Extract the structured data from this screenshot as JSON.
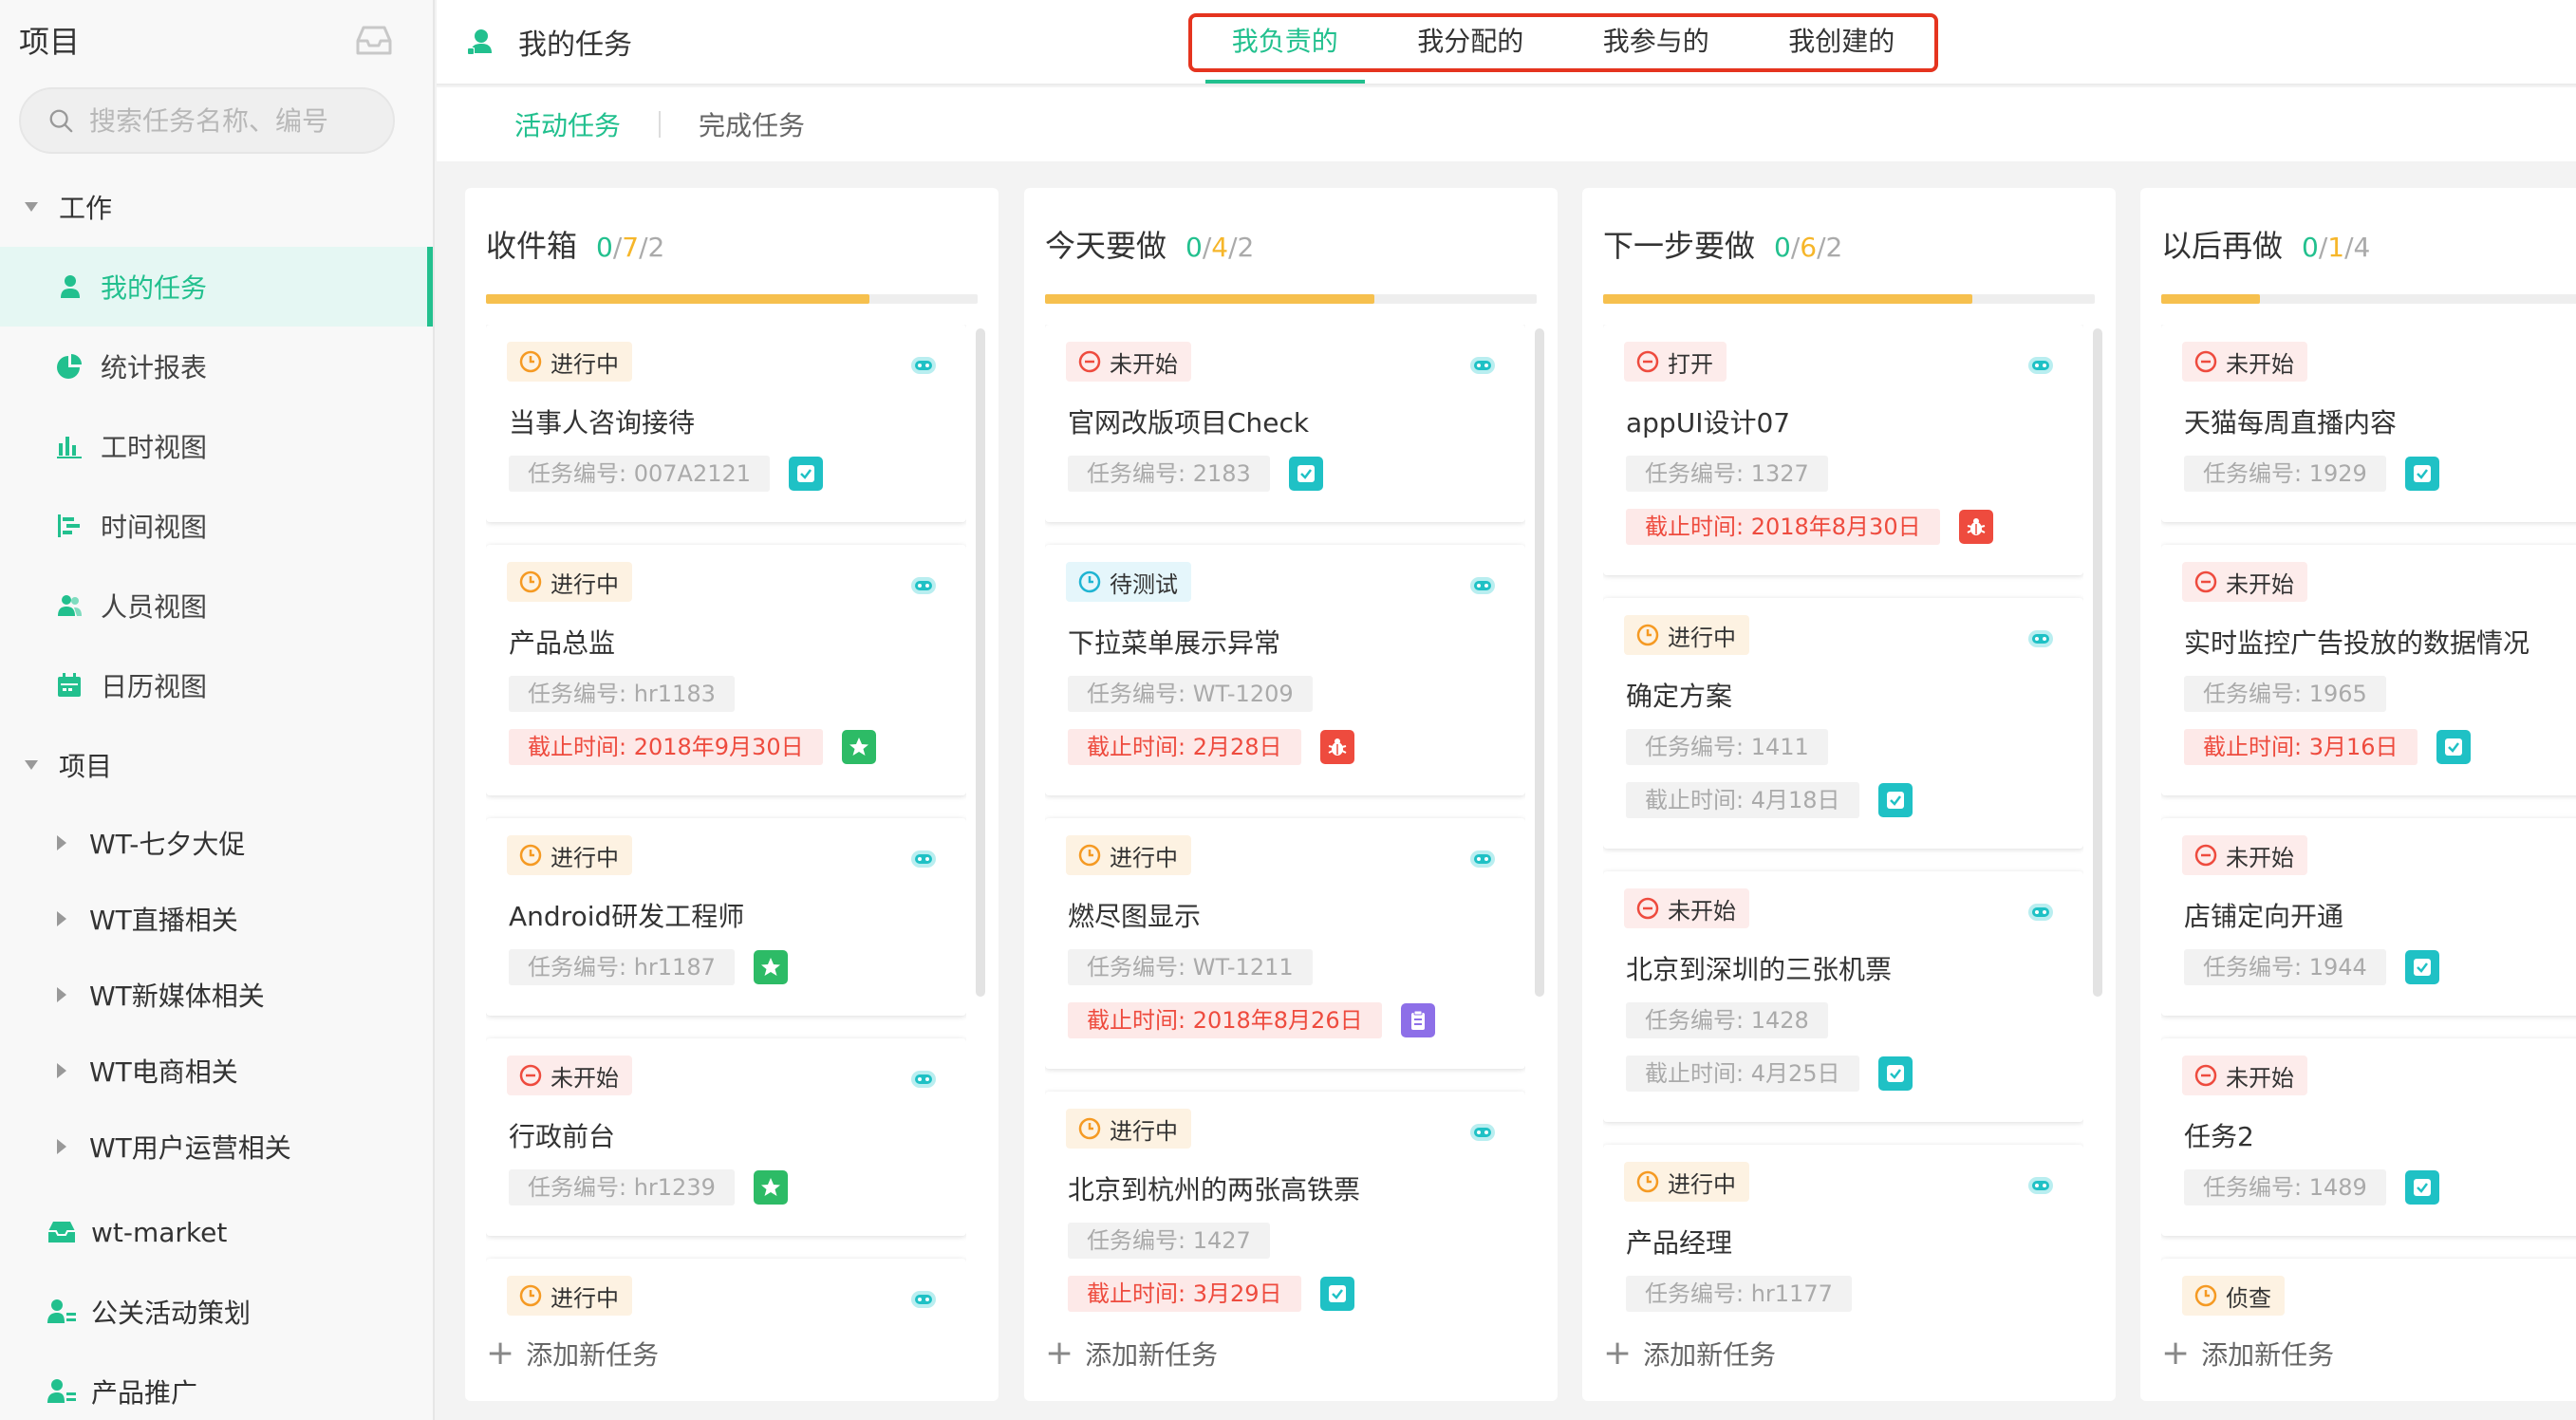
{
  "sidebar": {
    "title": "项目",
    "search_placeholder": "搜索任务名称、编号",
    "work_group": "工作",
    "work_items": [
      {
        "label": "我的任务",
        "icon": "user-icon",
        "active": true
      },
      {
        "label": "统计报表",
        "icon": "pie-chart-icon"
      },
      {
        "label": "工时视图",
        "icon": "bar-chart-icon"
      },
      {
        "label": "时间视图",
        "icon": "gantt-icon"
      },
      {
        "label": "人员视图",
        "icon": "users-icon"
      },
      {
        "label": "日历视图",
        "icon": "calendar-icon"
      }
    ],
    "project_group": "项目",
    "projects": [
      "WT-七夕大促",
      "WT直播相关",
      "WT新媒体相关",
      "WT电商相关",
      "WT用户运营相关"
    ],
    "other_projects": [
      {
        "label": "wt-market",
        "icon": "inbox-icon"
      },
      {
        "label": "公关活动策划",
        "icon": "user-list-icon"
      },
      {
        "label": "产品推广",
        "icon": "user-list-icon"
      }
    ]
  },
  "header": {
    "title": "我的任务",
    "tabs": [
      "我负责的",
      "我分配的",
      "我参与的",
      "我创建的"
    ],
    "active_tab": 0
  },
  "subtabs": [
    "活动任务",
    "完成任务"
  ],
  "columns": [
    {
      "title": "收件箱",
      "count_done": "0",
      "count_total": "7",
      "count_other": "2",
      "progress": 0.78,
      "cards": [
        {
          "status": "进行中",
          "status_type": "orange",
          "title": "当事人咨询接待",
          "number": "任务编号: 007A2121",
          "type_icon": "check-icon",
          "type_color": "teal"
        },
        {
          "status": "进行中",
          "status_type": "orange",
          "title": "产品总监",
          "number": "任务编号: hr1183",
          "due": "截止时间: 2018年9月30日",
          "due_style": "red",
          "type_icon": "star-icon",
          "type_color": "green"
        },
        {
          "status": "进行中",
          "status_type": "orange",
          "title": "Android研发工程师",
          "number": "任务编号: hr1187",
          "type_icon": "star-icon",
          "type_color": "green"
        },
        {
          "status": "未开始",
          "status_type": "red",
          "title": "行政前台",
          "number": "任务编号: hr1239",
          "type_icon": "star-icon",
          "type_color": "green"
        },
        {
          "status": "进行中",
          "status_type": "orange",
          "title": "",
          "number": ""
        }
      ]
    },
    {
      "title": "今天要做",
      "count_done": "0",
      "count_total": "4",
      "count_other": "2",
      "progress": 0.67,
      "cards": [
        {
          "status": "未开始",
          "status_type": "red",
          "title": "官网改版项目Check",
          "number": "任务编号: 2183",
          "type_icon": "check-icon",
          "type_color": "teal"
        },
        {
          "status": "待测试",
          "status_type": "blue",
          "title": "下拉菜单展示异常",
          "number": "任务编号: WT-1209",
          "due": "截止时间: 2月28日",
          "due_style": "red",
          "type_icon": "bug-icon",
          "type_color": "red"
        },
        {
          "status": "进行中",
          "status_type": "orange",
          "title": "燃尽图显示",
          "number": "任务编号: WT-1211",
          "due": "截止时间: 2018年8月26日",
          "due_style": "red",
          "type_icon": "clipboard-icon",
          "type_color": "purple"
        },
        {
          "status": "进行中",
          "status_type": "orange",
          "title": "北京到杭州的两张高铁票",
          "number": "任务编号: 1427",
          "due": "截止时间: 3月29日",
          "due_style": "red",
          "type_icon": "check-icon",
          "type_color": "teal"
        }
      ]
    },
    {
      "title": "下一步要做",
      "count_done": "0",
      "count_total": "6",
      "count_other": "2",
      "progress": 0.75,
      "cards": [
        {
          "status": "打开",
          "status_type": "red",
          "title": "appUI设计07",
          "number": "任务编号: 1327",
          "due": "截止时间: 2018年8月30日",
          "due_style": "red",
          "type_icon": "bug-icon",
          "type_color": "red"
        },
        {
          "status": "进行中",
          "status_type": "orange",
          "title": "确定方案",
          "number": "任务编号: 1411",
          "due": "截止时间: 4月18日",
          "due_style": "grey",
          "type_icon": "check-icon",
          "type_color": "teal"
        },
        {
          "status": "未开始",
          "status_type": "red",
          "title": "北京到深圳的三张机票",
          "number": "任务编号: 1428",
          "due": "截止时间: 4月25日",
          "due_style": "grey",
          "type_icon": "check-icon",
          "type_color": "teal"
        },
        {
          "status": "进行中",
          "status_type": "orange",
          "title": "产品经理",
          "number": "任务编号: hr1177"
        }
      ]
    },
    {
      "title": "以后再做",
      "count_done": "0",
      "count_total": "1",
      "count_other": "4",
      "progress": 0.2,
      "cards": [
        {
          "status": "未开始",
          "status_type": "red",
          "title": "天猫每周直播内容",
          "number": "任务编号: 1929",
          "type_icon": "check-icon",
          "type_color": "teal"
        },
        {
          "status": "未开始",
          "status_type": "red",
          "title": "实时监控广告投放的数据情况",
          "number": "任务编号: 1965",
          "due": "截止时间: 3月16日",
          "due_style": "red",
          "type_icon": "check-icon",
          "type_color": "teal"
        },
        {
          "status": "未开始",
          "status_type": "red",
          "title": "店铺定向开通",
          "number": "任务编号: 1944",
          "type_icon": "check-icon",
          "type_color": "teal"
        },
        {
          "status": "未开始",
          "status_type": "red",
          "title": "任务2",
          "number": "任务编号: 1489",
          "type_icon": "check-icon",
          "type_color": "teal"
        },
        {
          "status": "侦查",
          "status_type": "orange",
          "title": "",
          "number": ""
        }
      ]
    }
  ],
  "add_task_label": "添加新任务",
  "colors": {
    "accent": "#22c08e",
    "highlight_border": "#e5341f",
    "progress": "#f6c04e"
  }
}
